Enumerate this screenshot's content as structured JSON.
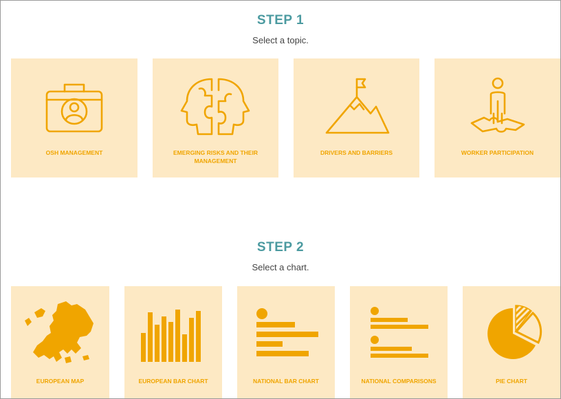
{
  "step1": {
    "title": "STEP 1",
    "subtitle": "Select a topic.",
    "topics": [
      {
        "label": "OSH MANAGEMENT",
        "icon": "briefcase-person-icon"
      },
      {
        "label": "EMERGING RISKS AND THEIR MANAGEMENT",
        "icon": "puzzle-heads-icon"
      },
      {
        "label": "DRIVERS AND BARRIERS",
        "icon": "mountain-flag-icon"
      },
      {
        "label": "WORKER PARTICIPATION",
        "icon": "worker-puzzle-icon"
      }
    ]
  },
  "step2": {
    "title": "STEP 2",
    "subtitle": "Select a chart.",
    "charts": [
      {
        "label": "EUROPEAN MAP",
        "icon": "europe-map-icon"
      },
      {
        "label": "EUROPEAN BAR CHART",
        "icon": "vertical-bar-chart-icon"
      },
      {
        "label": "NATIONAL BAR CHART",
        "icon": "horizontal-bar-chart-icon"
      },
      {
        "label": "NATIONAL COMPARISONS",
        "icon": "comparison-chart-icon"
      },
      {
        "label": "PIE CHART",
        "icon": "pie-chart-icon"
      }
    ]
  },
  "colors": {
    "accent": "#f0a500",
    "card_background": "#fde9c4",
    "step_title": "#4b9aa0"
  }
}
